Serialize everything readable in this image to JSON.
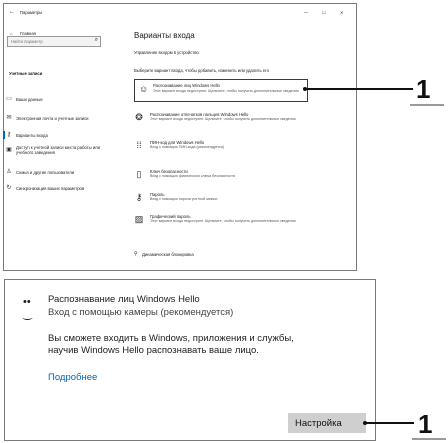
{
  "window": {
    "title": "Параметры",
    "controls": [
      "—",
      "☐",
      "✕"
    ],
    "back_icon": "back-arrow-icon"
  },
  "sidebar": {
    "home_label": "Главная",
    "search_placeholder": "Найти параметр",
    "section_title": "Учетные записи",
    "items": [
      {
        "icon": "person-card-icon",
        "label": "Ваши данные"
      },
      {
        "icon": "envelope-icon",
        "label": "Электронная почта и учетные записи"
      },
      {
        "icon": "key-icon",
        "label": "Варианты входа"
      },
      {
        "icon": "briefcase-icon",
        "label": "Доступ к учетной записи места работы или учебного заведения"
      },
      {
        "icon": "people-icon",
        "label": "Семья и другие пользователи"
      },
      {
        "icon": "sync-icon",
        "label": "Синхронизация ваших параметров"
      }
    ]
  },
  "main": {
    "title": "Варианты входа",
    "subtitle": "Управление входом в устройство",
    "prompt": "Выберите вариант входа, чтобы добавить, изменить или удалить его",
    "options": [
      {
        "icon": "face-icon",
        "title": "Распознавание лиц Windows Hello",
        "desc": "Этот вариант входа недоступен. Щелкните, чтобы получить дополнительные сведения"
      },
      {
        "icon": "fingerprint-icon",
        "title": "Распознавание отпечатков пальцев Windows Hello",
        "desc": "Этот вариант входа недоступен. Щелкните, чтобы получить дополнительные сведения"
      },
      {
        "icon": "pin-icon",
        "title": "ПИН-код для Windows Hello",
        "desc": "Вход с помощью ПИН-кода (рекомендуется)"
      },
      {
        "icon": "security-key-icon",
        "title": "Ключ безопасности",
        "desc": "Вход с помощью физического ключа безопасности"
      },
      {
        "icon": "key-icon",
        "title": "Пароль",
        "desc": "Вход с помощью пароля учетной записи"
      },
      {
        "icon": "picture-icon",
        "title": "Графический пароль",
        "desc": "Этот вариант входа недоступен. Щелкните, чтобы получить дополнительные сведения"
      }
    ],
    "dynamic_lock": "Динамическая блокировка"
  },
  "panel": {
    "title": "Распознавание лиц Windows Hello",
    "subtitle": "Вход с помощью камеры (рекомендуется)",
    "body_line1": "Вы сможете входить в Windows, приложения и службы,",
    "body_line2": "научив Windows Hello распознавать ваше лицо.",
    "link": "Подробнее",
    "button": "Настройка"
  },
  "callouts": [
    "1",
    "1"
  ]
}
